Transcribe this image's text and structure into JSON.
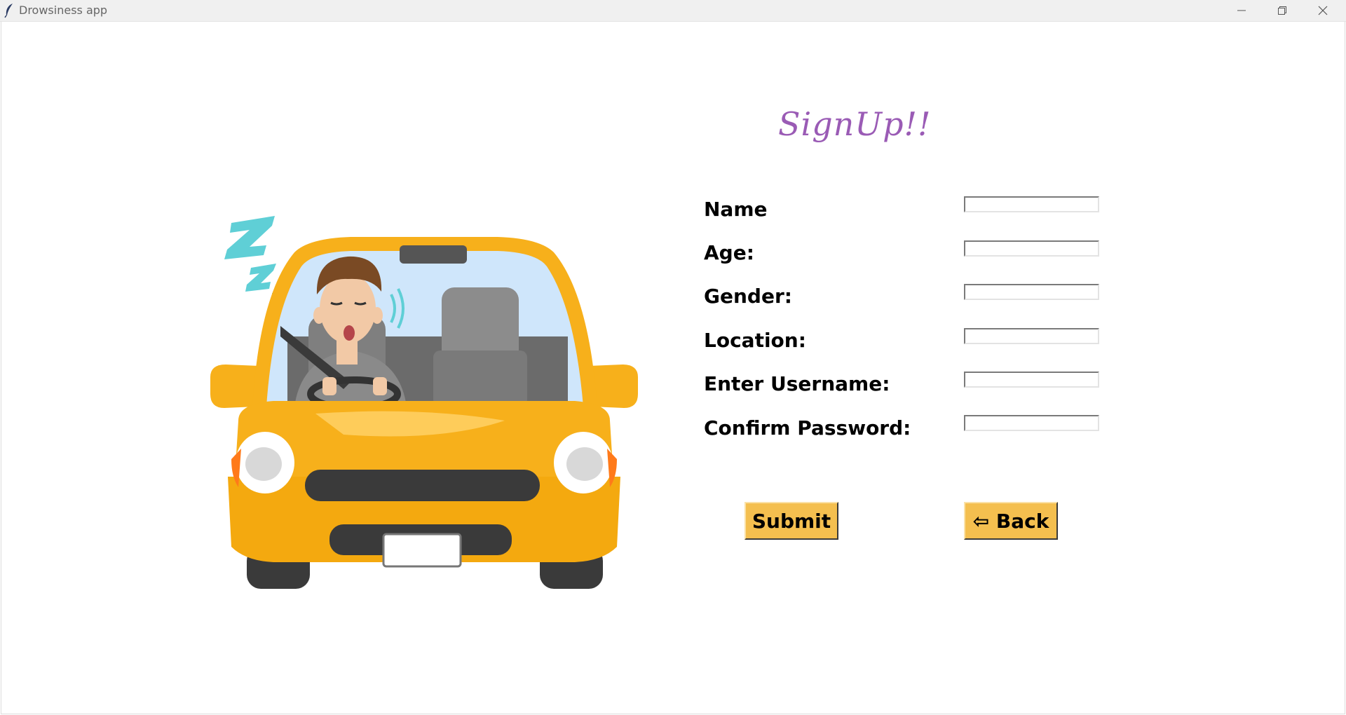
{
  "window": {
    "title": "Drowsiness app"
  },
  "form": {
    "heading": "SignUp!!",
    "fields": [
      {
        "label": "Name",
        "value": ""
      },
      {
        "label": "Age:",
        "value": ""
      },
      {
        "label": "Gender:",
        "value": ""
      },
      {
        "label": "Location:",
        "value": ""
      },
      {
        "label": "Enter Username:",
        "value": ""
      },
      {
        "label": "Confirm Password:",
        "value": ""
      }
    ],
    "submit_label": "Submit",
    "back_label": "⇦ Back"
  },
  "colors": {
    "heading": "#9a5bb5",
    "button_bg": "#f4bf4f",
    "car_body": "#f7b01b"
  },
  "icons": {
    "app": "feather-icon",
    "minimize": "minimize-icon",
    "restore": "restore-icon",
    "close": "close-icon",
    "illustration": "drowsy-driver-car-illustration"
  }
}
